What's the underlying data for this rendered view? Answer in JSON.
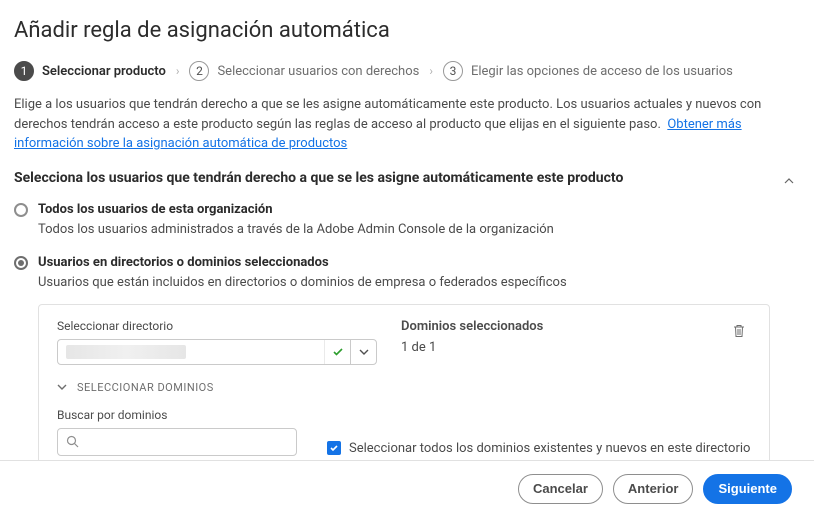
{
  "title": "Añadir regla de asignación automática",
  "steps": [
    {
      "num": "1",
      "label": "Seleccionar producto",
      "active": true
    },
    {
      "num": "2",
      "label": "Seleccionar usuarios con derechos",
      "active": false
    },
    {
      "num": "3",
      "label": "Elegir las opciones de acceso de los usuarios",
      "active": false
    }
  ],
  "description": "Elige a los usuarios que tendrán derecho a que se les asigne automáticamente este producto. Los usuarios actuales y nuevos con derechos tendrán acceso a este producto según las reglas de acceso al producto que elijas en el siguiente paso.",
  "learn_more_link": "Obtener más información sobre la asignación automática de productos",
  "section_heading": "Selecciona los usuarios que tendrán derecho a que se les asigne automáticamente este producto",
  "radio_options": {
    "all": {
      "label": "Todos los usuarios de esta organización",
      "desc": "Todos los usuarios administrados a través de la Adobe Admin Console de la organización"
    },
    "selected": {
      "label": "Usuarios en directorios o dominios seleccionados",
      "desc": "Usuarios que están incluidos en directorios o dominios de empresa o federados específicos"
    }
  },
  "panel": {
    "directory_label": "Seleccionar directorio",
    "domains_label": "Dominios seleccionados",
    "domains_count": "1 de 1",
    "collapsible_label": "SELECCIONAR DOMINIOS",
    "search_label": "Buscar por dominios",
    "search_placeholder": "",
    "select_all_label": "Seleccionar todos los dominios existentes y nuevos en este directorio"
  },
  "footer": {
    "cancel": "Cancelar",
    "prev": "Anterior",
    "next": "Siguiente"
  },
  "colors": {
    "primary": "#1473e6",
    "text": "#2c2c2c",
    "muted": "#6e6e6e"
  }
}
